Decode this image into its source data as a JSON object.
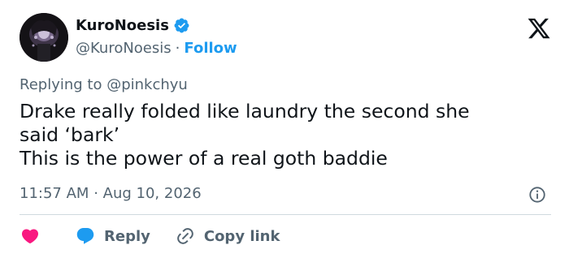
{
  "tweet": {
    "author": {
      "display_name": "KuroNoesis",
      "handle": "@KuroNoesis",
      "verified": true,
      "avatar_icon": "avatar-image"
    },
    "header": {
      "separator": "·",
      "follow_label": "Follow",
      "platform_icon": "x-logo-icon"
    },
    "replying_to": {
      "prefix": "Replying to",
      "mention": "@pinkchyu"
    },
    "text_lines": [
      "Drake really folded like laundry the second she",
      "said ‘bark’",
      "This is the power of a real goth baddie"
    ],
    "timestamp": {
      "time": "11:57 AM",
      "separator": "·",
      "date": "Aug 10, 2026"
    },
    "actions": {
      "like_icon": "heart-icon",
      "reply_label": "Reply",
      "copy_label": "Copy link"
    }
  },
  "colors": {
    "accent": "#1d9bf0",
    "text": "#0f1419",
    "muted": "#536471",
    "like": "#f91880",
    "divider": "#cfd9de"
  }
}
